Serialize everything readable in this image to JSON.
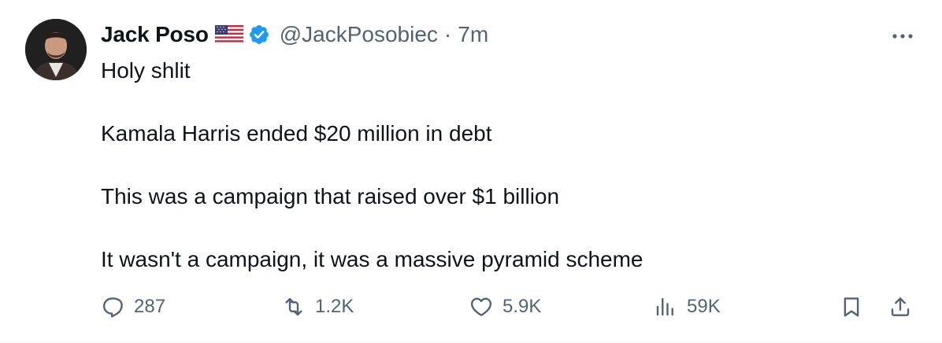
{
  "author": {
    "display_name": "Jack Poso",
    "handle": "@JackPosobiec",
    "separator": "·",
    "timestamp": "7m",
    "flag_icon": "us-flag-icon",
    "verified_icon": "verified-badge-icon",
    "verified_color": "#1d9bf0"
  },
  "tweet": {
    "lines": [
      "Holy shlit",
      "Kamala Harris ended $20 million in debt",
      "This was a campaign that raised over $1 billion",
      "It wasn't a campaign, it was a massive pyramid scheme"
    ]
  },
  "actions": {
    "reply": {
      "icon": "reply-icon",
      "count": "287"
    },
    "retweet": {
      "icon": "retweet-icon",
      "count": "1.2K"
    },
    "like": {
      "icon": "heart-icon",
      "count": "5.9K"
    },
    "views": {
      "icon": "views-icon",
      "count": "59K"
    },
    "bookmark": {
      "icon": "bookmark-icon"
    },
    "share": {
      "icon": "share-icon"
    }
  },
  "colors": {
    "text_primary": "#0f1419",
    "text_secondary": "#536471",
    "background": "#ffffff"
  }
}
